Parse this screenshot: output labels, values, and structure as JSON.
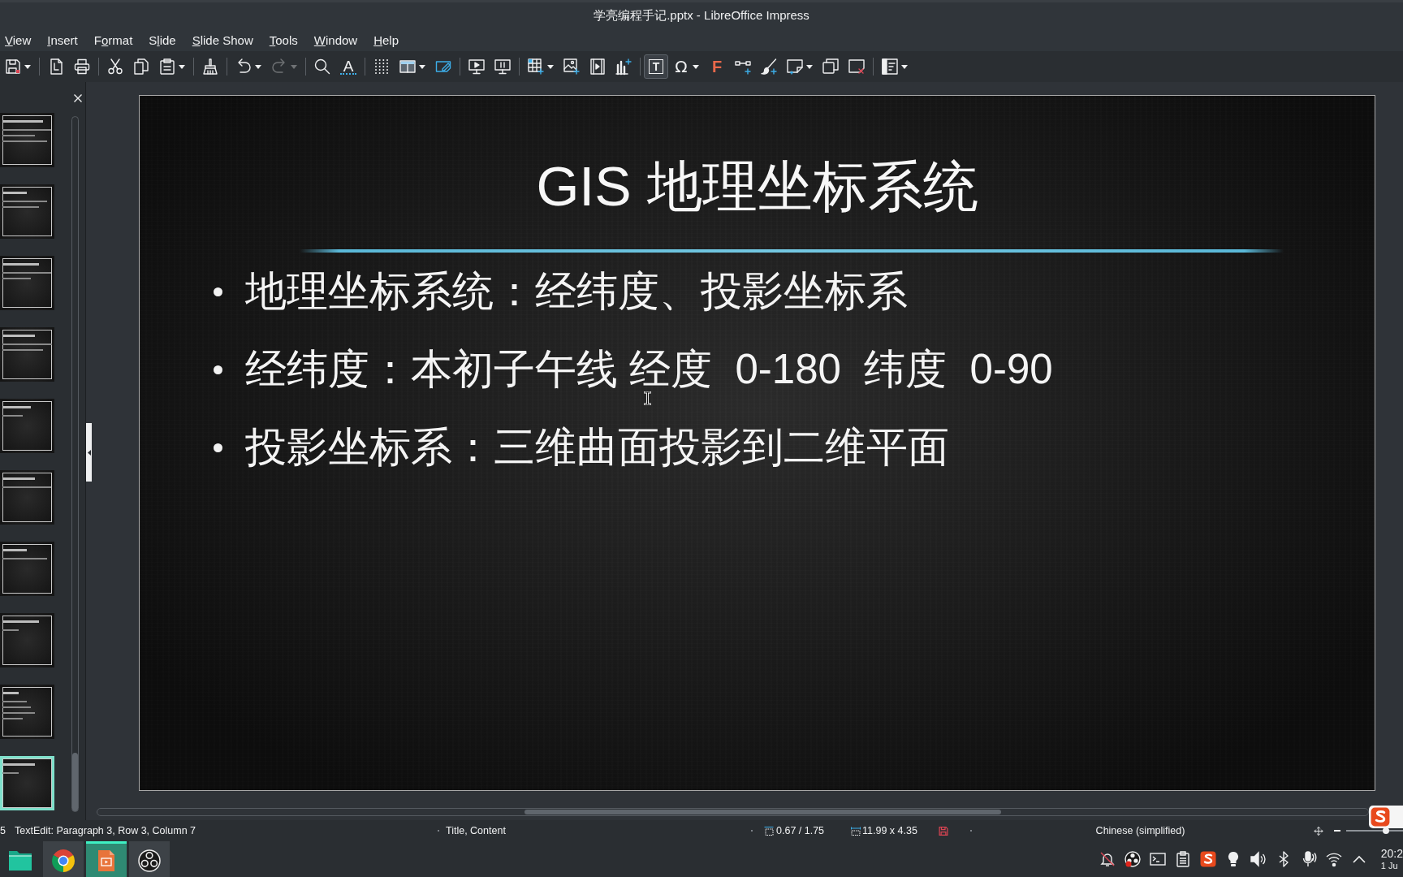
{
  "window": {
    "title": "学亮编程手记.pptx - LibreOffice Impress"
  },
  "menu": [
    {
      "key": "V",
      "post": "iew"
    },
    {
      "key": "I",
      "post": "nsert"
    },
    {
      "pre": "F",
      "key": "o",
      "post": "rmat"
    },
    {
      "pre": "S",
      "key": "l",
      "post": "ide"
    },
    {
      "key": "S",
      "post": "lide Show"
    },
    {
      "key": "T",
      "post": "ools"
    },
    {
      "key": "W",
      "post": "indow"
    },
    {
      "key": "H",
      "post": "elp"
    }
  ],
  "toolbar": [
    [
      {
        "dropdown": true,
        "selected": false,
        "disabled": false
      }
    ],
    [
      {
        "dropdown": false,
        "selected": false,
        "disabled": false
      },
      {
        "dropdown": false,
        "selected": false,
        "disabled": false
      }
    ],
    [
      {
        "dropdown": false,
        "selected": false,
        "disabled": false
      },
      {
        "dropdown": false,
        "selected": false,
        "disabled": false
      },
      {
        "dropdown": true,
        "selected": false,
        "disabled": false
      }
    ],
    [
      {
        "dropdown": false,
        "selected": false,
        "disabled": false
      }
    ],
    [
      {
        "dropdown": true,
        "selected": false,
        "disabled": false
      },
      {
        "dropdown": true,
        "selected": false,
        "disabled": true
      }
    ],
    [
      {
        "dropdown": false,
        "selected": false,
        "disabled": false
      },
      {
        "glyph": "A",
        "dropdown": false,
        "selected": false,
        "disabled": false
      }
    ],
    [
      {
        "dropdown": false,
        "selected": false,
        "disabled": false
      },
      {
        "dropdown": true,
        "selected": false,
        "disabled": false
      },
      {
        "dropdown": false,
        "selected": false,
        "disabled": false
      }
    ],
    [
      {
        "dropdown": false,
        "selected": false,
        "disabled": false
      },
      {
        "dropdown": false,
        "selected": false,
        "disabled": false
      }
    ],
    [
      {
        "dropdown": true,
        "selected": false,
        "disabled": false
      },
      {
        "dropdown": false,
        "selected": false,
        "disabled": false
      },
      {
        "dropdown": false,
        "selected": false,
        "disabled": false
      },
      {
        "dropdown": false,
        "selected": false,
        "disabled": false
      }
    ],
    [
      {
        "glyph": "T",
        "dropdown": false,
        "selected": true,
        "disabled": false
      },
      {
        "glyph": "Ω",
        "dropdown": true,
        "selected": false,
        "disabled": false
      },
      {
        "glyph": "F",
        "dropdown": false,
        "selected": false,
        "disabled": false
      },
      {
        "dropdown": false,
        "selected": false,
        "disabled": false
      },
      {
        "dropdown": false,
        "selected": false,
        "disabled": false
      },
      {
        "dropdown": true,
        "selected": false,
        "disabled": false
      },
      {
        "dropdown": false,
        "selected": false,
        "disabled": false
      },
      {
        "dropdown": false,
        "selected": false,
        "disabled": false
      }
    ],
    [
      {
        "dropdown": true,
        "selected": false,
        "disabled": false
      }
    ]
  ],
  "slides_pane": {
    "thumbnails": [
      {
        "selected": false
      },
      {
        "selected": false
      },
      {
        "selected": false
      },
      {
        "selected": false
      },
      {
        "selected": false
      },
      {
        "selected": false
      },
      {
        "selected": false
      },
      {
        "selected": false
      },
      {
        "selected": false
      },
      {
        "selected": true
      }
    ]
  },
  "slide": {
    "title": "GIS 地理坐标系统",
    "bullets": [
      "地理坐标系统：经纬度、投影坐标系",
      "经纬度：本初子午线 经度  0-180  纬度  0-90",
      "投影坐标系：三维曲面投影到二维平面"
    ]
  },
  "status_bar": {
    "slide_number": "5",
    "edit_status": "TextEdit: Paragraph 3, Row 3, Column 7",
    "layout": "Title, Content",
    "position": "0.67 / 1.75",
    "size": "11.99 x 4.35",
    "document_modified": true,
    "language": "Chinese (simplified)",
    "zoom": {
      "level": 0.7
    }
  },
  "taskbar": {
    "apps": [
      {
        "running": false,
        "selected": false
      },
      {
        "running": true,
        "selected": false
      },
      {
        "running": true,
        "selected": true
      },
      {
        "running": true,
        "selected": false
      }
    ],
    "clock": {
      "time": "20:2",
      "date": "1 Ju"
    }
  }
}
